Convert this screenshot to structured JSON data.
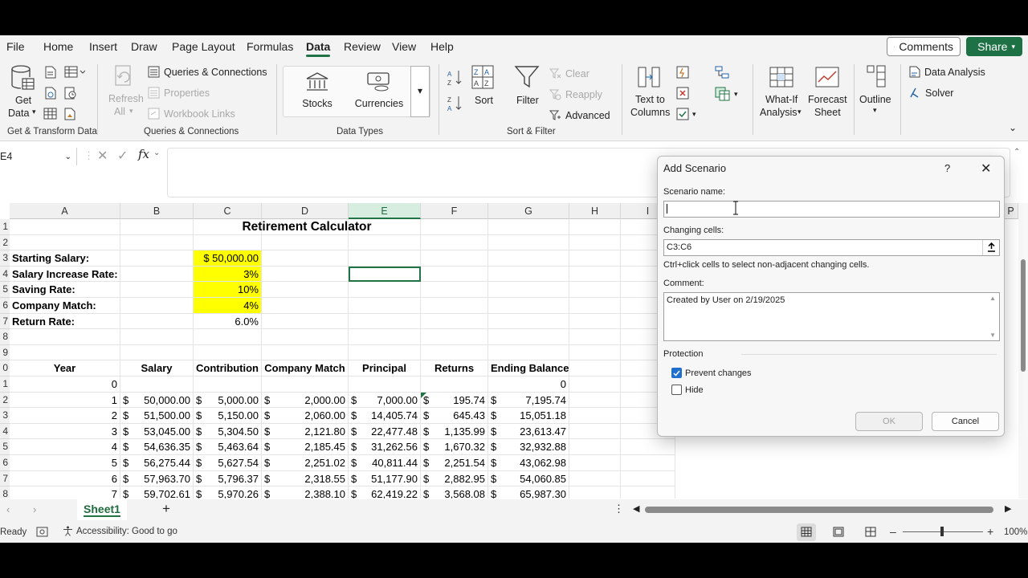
{
  "menu": {
    "tabs": [
      "File",
      "Home",
      "Insert",
      "Draw",
      "Page Layout",
      "Formulas",
      "Data",
      "Review",
      "View",
      "Help"
    ],
    "active": "Data",
    "comments_label": "Comments",
    "share_label": "Share"
  },
  "ribbon": {
    "get_data": "Get",
    "get_data2": "Data",
    "group_get_transform": "Get & Transform Data",
    "refresh": "Refresh",
    "refresh_all": "All",
    "queries_connections": "Queries & Connections",
    "properties": "Properties",
    "workbook_links": "Workbook Links",
    "group_queries": "Queries & Connections",
    "stocks": "Stocks",
    "currencies": "Currencies",
    "group_data_types": "Data Types",
    "sort": "Sort",
    "filter": "Filter",
    "clear": "Clear",
    "reapply": "Reapply",
    "advanced": "Advanced",
    "group_sort_filter": "Sort & Filter",
    "text_to_columns_1": "Text to",
    "text_to_columns_2": "Columns",
    "what_if_1": "What-If",
    "what_if_2": "Analysis",
    "forecast_1": "Forecast",
    "forecast_2": "Sheet",
    "outline": "Outline",
    "data_analysis": "Data Analysis",
    "solver": "Solver"
  },
  "formula_bar": {
    "name_box": "E4",
    "fx": "fx"
  },
  "columns": [
    "A",
    "B",
    "C",
    "D",
    "E",
    "F",
    "G",
    "H",
    "I",
    "P"
  ],
  "sheet": {
    "title": "Retirement Calculator",
    "params": [
      {
        "row": "3",
        "label": "Starting Salary:",
        "value": "$ 50,000.00"
      },
      {
        "row": "4",
        "label": "Salary Increase Rate:",
        "value": "3%"
      },
      {
        "row": "5",
        "label": "Saving Rate:",
        "value": "10%"
      },
      {
        "row": "6",
        "label": "Company Match:",
        "value": "4%"
      },
      {
        "row": "7",
        "label": "Return Rate:",
        "value": "6.0%"
      }
    ],
    "headers": [
      "Year",
      "Salary",
      "Contribution",
      "Company Match",
      "Principal",
      "Returns",
      "Ending Balance"
    ],
    "row0_year": "0",
    "row0_end": "0",
    "dollar": "$",
    "data": [
      [
        "1",
        "50,000.00",
        "5,000.00",
        "2,000.00",
        "7,000.00",
        "195.74",
        "7,195.74"
      ],
      [
        "2",
        "51,500.00",
        "5,150.00",
        "2,060.00",
        "14,405.74",
        "645.43",
        "15,051.18"
      ],
      [
        "3",
        "53,045.00",
        "5,304.50",
        "2,121.80",
        "22,477.48",
        "1,135.99",
        "23,613.47"
      ],
      [
        "4",
        "54,636.35",
        "5,463.64",
        "2,185.45",
        "31,262.56",
        "1,670.32",
        "32,932.88"
      ],
      [
        "5",
        "56,275.44",
        "5,627.54",
        "2,251.02",
        "40,811.44",
        "2,251.54",
        "43,062.98"
      ],
      [
        "6",
        "57,963.70",
        "5,796.37",
        "2,318.55",
        "51,177.90",
        "2,882.95",
        "54,060.85"
      ],
      [
        "7",
        "59,702.61",
        "5,970.26",
        "2,388.10",
        "62,419.22",
        "3,568.08",
        "65,987.30"
      ]
    ],
    "row_numbers": [
      "1",
      "2",
      "3",
      "4",
      "5",
      "6",
      "7",
      "8",
      "9",
      "0",
      "1",
      "2",
      "3",
      "4",
      "5",
      "6",
      "7",
      "8"
    ]
  },
  "sheet_tabs": {
    "active": "Sheet1",
    "add": "+"
  },
  "status": {
    "ready": "Ready",
    "accessibility": "Accessibility: Good to go",
    "zoom": "100%"
  },
  "dialog": {
    "title": "Add Scenario",
    "help": "?",
    "scenario_name_label": "Scenario name:",
    "scenario_name_value": "",
    "changing_cells_label": "Changing cells:",
    "changing_cells_value": "C3:C6",
    "hint": "Ctrl+click cells to select non-adjacent changing cells.",
    "comment_label": "Comment:",
    "comment_value": "Created by User on 2/19/2025",
    "protection_label": "Protection",
    "prevent_changes_label": "Prevent changes",
    "prevent_changes_checked": true,
    "hide_label": "Hide",
    "hide_checked": false,
    "ok_label": "OK",
    "cancel_label": "Cancel"
  },
  "colors": {
    "accent": "#217346",
    "highlight": "#ffff00",
    "checkbox": "#1f6fcf"
  }
}
